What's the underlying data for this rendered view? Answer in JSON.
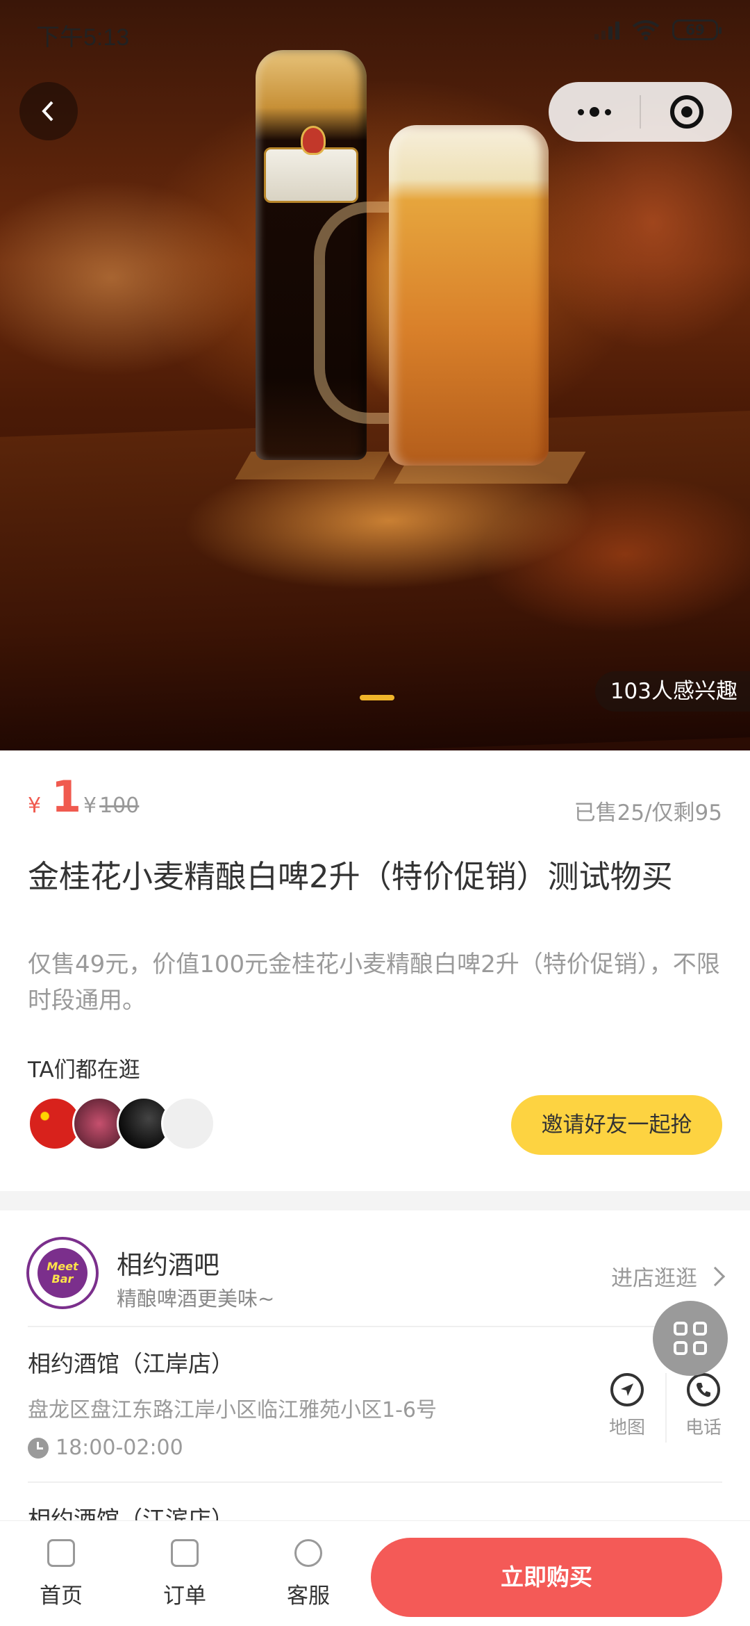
{
  "status_bar": {
    "time": "下午5:13",
    "battery": "69"
  },
  "hero": {
    "interest_text": "103人感兴趣"
  },
  "price": {
    "currency": "¥",
    "current": "1",
    "original_currency": "¥",
    "original": "100",
    "sold_info": "已售25/仅剩95"
  },
  "product": {
    "title": "金桂花小麦精酿白啤2升（特价促销）测试物买",
    "description": "仅售49元，价值100元金桂花小麦精酿白啤2升（特价促销），不限时段通用。"
  },
  "social": {
    "label": "TA们都在逛",
    "invite_button": "邀请好友一起抢"
  },
  "store": {
    "logo_text": "Meet Bar",
    "name": "相约酒吧",
    "slogan": "精酿啤酒更美味~",
    "visit_label": "进店逛逛"
  },
  "branches": [
    {
      "name": "相约酒馆（江岸店）",
      "address": "盘龙区盘江东路江岸小区临江雅苑小区1-6号",
      "hours": "18:00-02:00"
    },
    {
      "name": "相约酒馆（江滨店）"
    }
  ],
  "actions": {
    "map": "地图",
    "phone": "电话"
  },
  "tabbar": {
    "home": "首页",
    "orders": "订单",
    "service": "客服",
    "buy": "立即购买"
  },
  "colors": {
    "accent": "#f45a57",
    "price": "#f05a4f",
    "invite": "#fdd341"
  }
}
